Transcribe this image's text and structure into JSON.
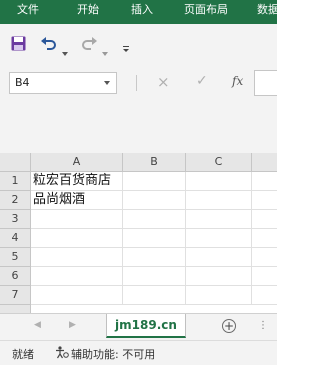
{
  "ribbon": {
    "tabs": [
      "文件",
      "开始",
      "插入",
      "页面布局",
      "数据"
    ],
    "bg_color": "#217346"
  },
  "qat": {
    "icons": [
      "save-icon",
      "undo-icon",
      "redo-icon",
      "customize-icon"
    ]
  },
  "formula_bar": {
    "name_box": "B4",
    "cancel_icon": "×",
    "enter_icon": "✓",
    "fx_label": "fx",
    "value": ""
  },
  "grid": {
    "columns": [
      "A",
      "B",
      "C"
    ],
    "rows": [
      "1",
      "2",
      "3",
      "4",
      "5",
      "6",
      "7"
    ],
    "cells": {
      "A1": "粒宏百货商店",
      "A2": "品尚烟酒"
    }
  },
  "sheets": {
    "tabs": [
      "jm189.cn"
    ],
    "active": "jm189.cn",
    "add_label": "+"
  },
  "status": {
    "ready": "就绪",
    "accessibility": "辅助功能: 不可用"
  }
}
